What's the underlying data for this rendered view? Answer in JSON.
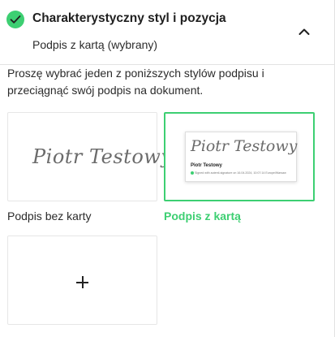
{
  "section": {
    "title": "Charakterystyczny styl i pozycja",
    "subtitle": "Podpis z kartą (wybrany)",
    "status_icon": "check-circle-icon",
    "toggle_icon": "chevron-up-icon",
    "instruction": "Proszę wybrać jeden z poniższych stylów podpisu i przeciągnąć swój podpis na dokument."
  },
  "styles": [
    {
      "label": "Podpis bez karty",
      "signature": "Piotr Testowy",
      "selected": false
    },
    {
      "label": "Podpis z kartą",
      "signature": "Piotr Testowy",
      "card_name": "Piotr Testowy",
      "card_meta": "Signed with autenti-signature on 16.04.2024, 10:07:14 Europe/Warsaw",
      "selected": true
    },
    {
      "label": "",
      "icon": "plus-icon",
      "selected": false
    }
  ],
  "colors": {
    "accent": "#3dcf72",
    "text": "#2b2b2b",
    "border": "#e6e6e6"
  }
}
